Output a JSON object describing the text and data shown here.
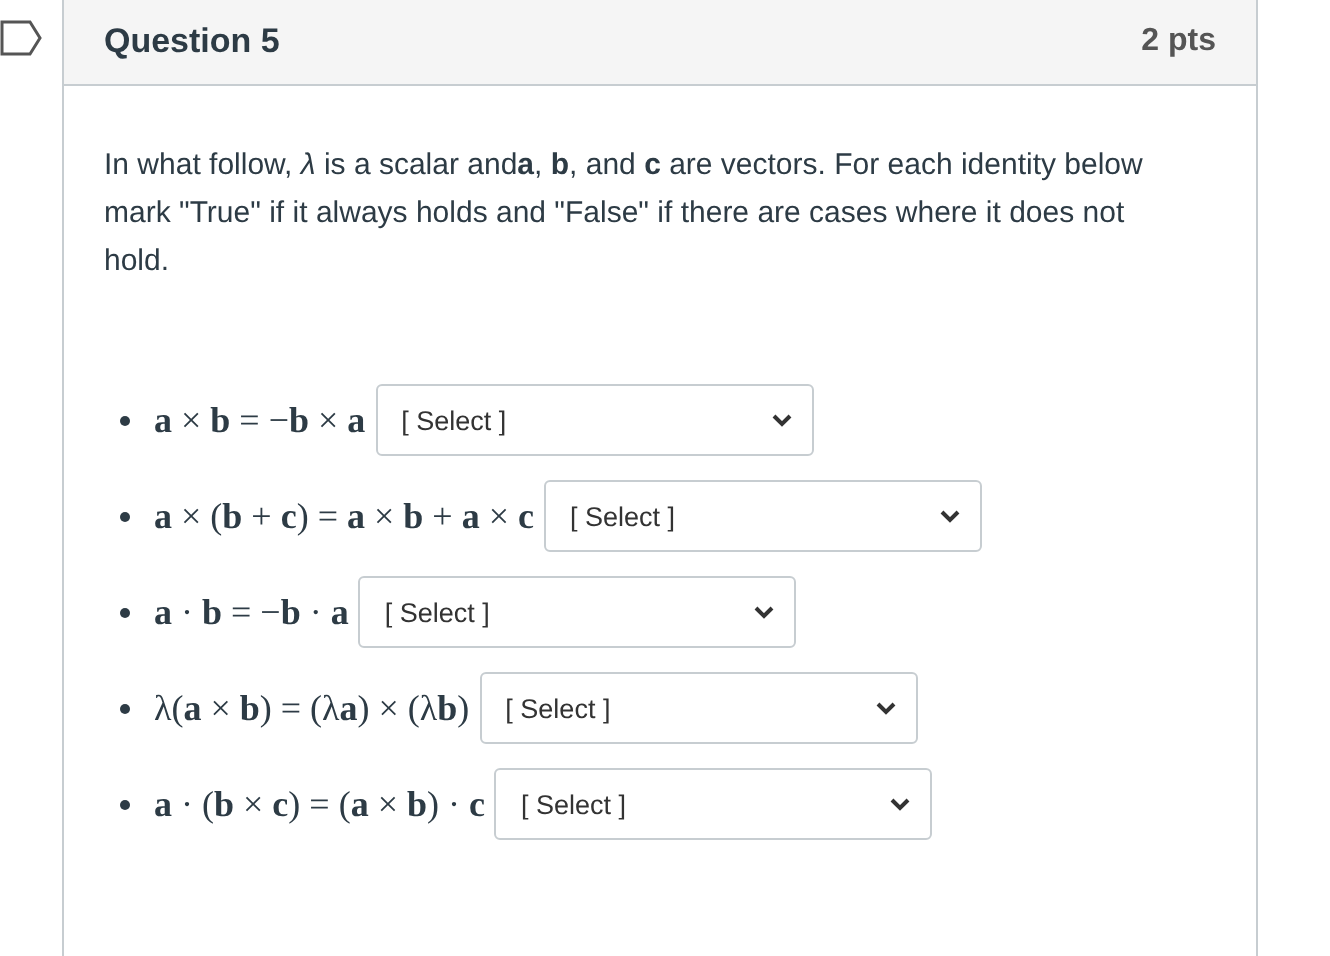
{
  "question": {
    "title": "Question 5",
    "points": "2 pts"
  },
  "prompt": "In what follow, *λ* is a scalar and**a**, **b**, and **c** are vectors.  For each identity below mark \"True\" if it always holds and \"False\" if there are cases where it does not hold.",
  "identities": [
    {
      "formula": "**a** × **b** = −**b** × **a**",
      "select": "[ Select ]"
    },
    {
      "formula": "**a** × (**b** + **c**) = **a** × **b** + **a** × **c**",
      "select": "[ Select ]"
    },
    {
      "formula": "**a** · **b** = −**b** · **a**",
      "select": "[ Select ]"
    },
    {
      "formula": "λ(**a** × **b**) = (λ**a**) × (λ**b**)",
      "select": "[ Select ]"
    },
    {
      "formula": "**a** · (**b** × **c**) = (**a** × **b**) · **c**",
      "select": "[ Select ]"
    }
  ]
}
